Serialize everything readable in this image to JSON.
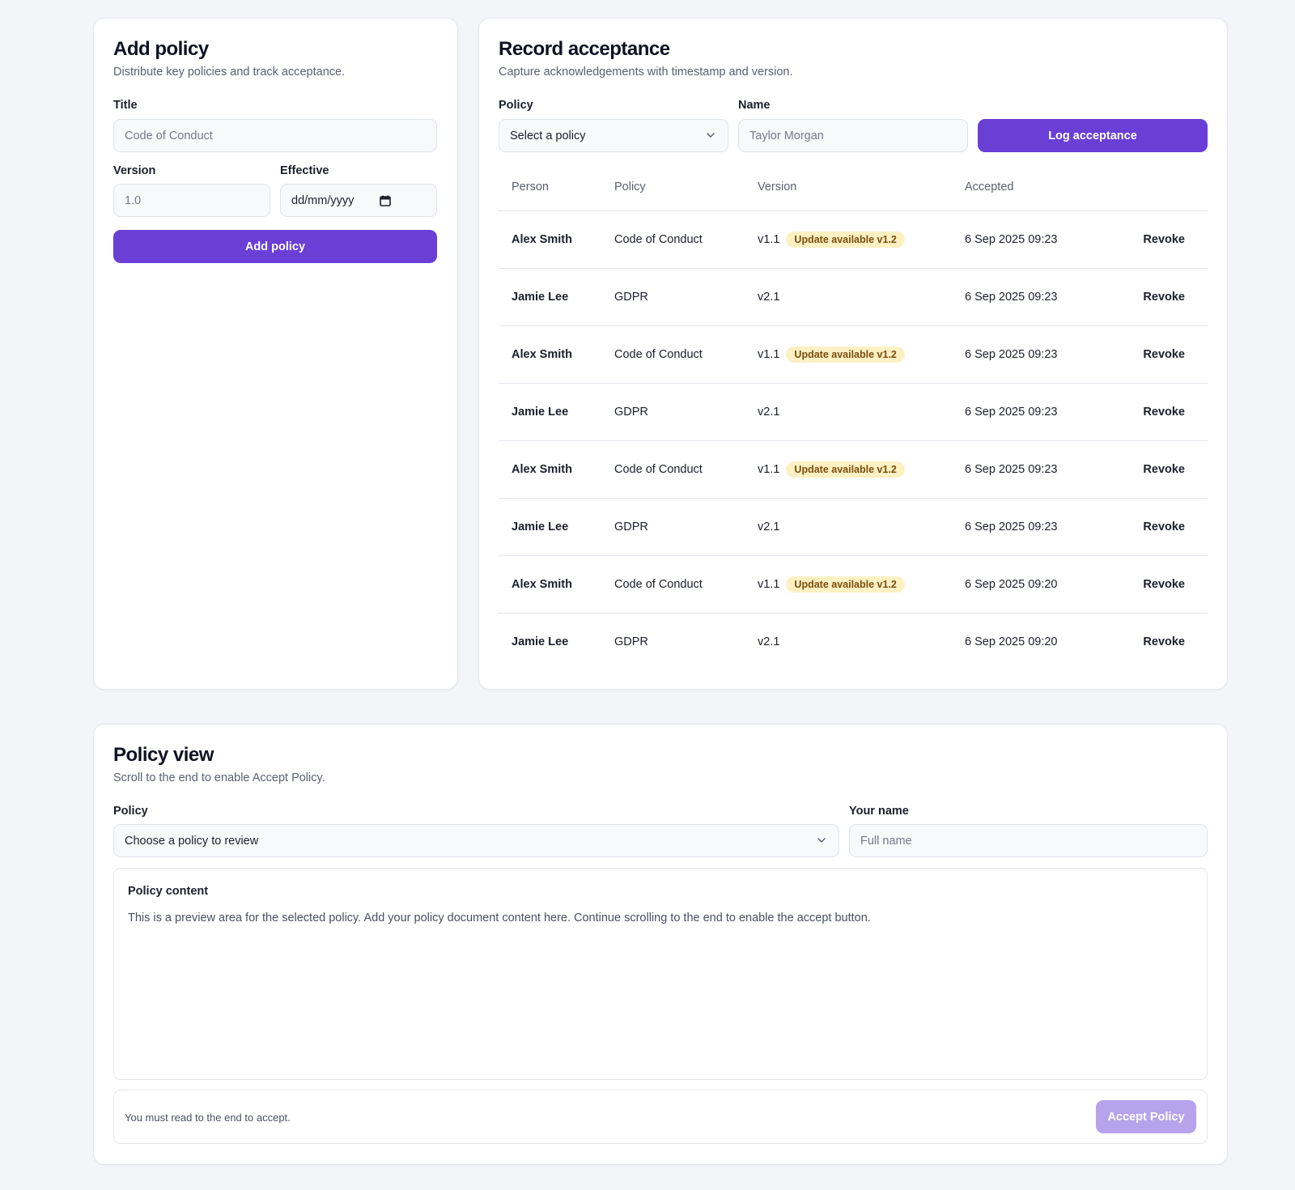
{
  "add_policy": {
    "title": "Add policy",
    "subtitle": "Distribute key policies and track acceptance.",
    "title_label": "Title",
    "title_placeholder": "Code of Conduct",
    "version_label": "Version",
    "version_placeholder": "1.0",
    "effective_label": "Effective",
    "effective_placeholder": "dd/mm/yyyy",
    "submit_label": "Add policy"
  },
  "record_acceptance": {
    "title": "Record acceptance",
    "subtitle": "Capture acknowledgements with timestamp and version.",
    "policy_label": "Policy",
    "policy_selected": "Select a policy",
    "name_label": "Name",
    "name_placeholder": "Taylor Morgan",
    "submit_label": "Log acceptance",
    "columns": [
      "Person",
      "Policy",
      "Version",
      "Accepted"
    ],
    "rows": [
      {
        "person": "Alex Smith",
        "policy": "Code of Conduct",
        "version": "v1.1",
        "badge": "Update available v1.2",
        "accepted": "6 Sep 2025 09:23",
        "action": "Revoke"
      },
      {
        "person": "Jamie Lee",
        "policy": "GDPR",
        "version": "v2.1",
        "badge": "",
        "accepted": "6 Sep 2025 09:23",
        "action": "Revoke"
      },
      {
        "person": "Alex Smith",
        "policy": "Code of Conduct",
        "version": "v1.1",
        "badge": "Update available v1.2",
        "accepted": "6 Sep 2025 09:23",
        "action": "Revoke"
      },
      {
        "person": "Jamie Lee",
        "policy": "GDPR",
        "version": "v2.1",
        "badge": "",
        "accepted": "6 Sep 2025 09:23",
        "action": "Revoke"
      },
      {
        "person": "Alex Smith",
        "policy": "Code of Conduct",
        "version": "v1.1",
        "badge": "Update available v1.2",
        "accepted": "6 Sep 2025 09:23",
        "action": "Revoke"
      },
      {
        "person": "Jamie Lee",
        "policy": "GDPR",
        "version": "v2.1",
        "badge": "",
        "accepted": "6 Sep 2025 09:23",
        "action": "Revoke"
      },
      {
        "person": "Alex Smith",
        "policy": "Code of Conduct",
        "version": "v1.1",
        "badge": "Update available v1.2",
        "accepted": "6 Sep 2025 09:20",
        "action": "Revoke"
      },
      {
        "person": "Jamie Lee",
        "policy": "GDPR",
        "version": "v2.1",
        "badge": "",
        "accepted": "6 Sep 2025 09:20",
        "action": "Revoke"
      }
    ]
  },
  "policy_view": {
    "title": "Policy view",
    "subtitle": "Scroll to the end to enable Accept Policy.",
    "policy_label": "Policy",
    "policy_selected": "Choose a policy to review",
    "name_label": "Your name",
    "name_placeholder": "Full name",
    "content_heading": "Policy content",
    "content_text": "This is a preview area for the selected policy. Add your policy document content here. Continue scrolling to the end to enable the accept button.",
    "footer_hint": "You must read to the end to accept.",
    "accept_label": "Accept Policy"
  },
  "colors": {
    "accent": "#6a3fd6",
    "accent_disabled": "#b7a3ec",
    "badge_bg": "#fdf1c4",
    "badge_text": "#7a4d0b",
    "background": "#f4f5f8"
  },
  "icons": [
    "chevron-down-icon",
    "calendar-icon"
  ]
}
